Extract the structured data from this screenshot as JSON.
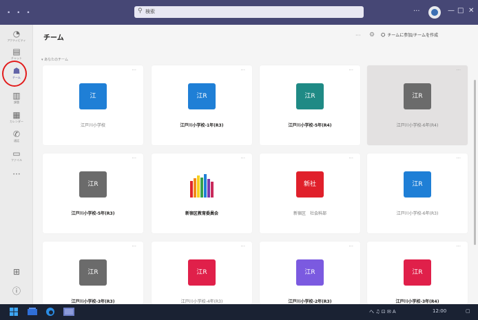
{
  "window": {
    "title_dots": "• • •",
    "search_placeholder": "検索",
    "more": "···",
    "minimize": "—",
    "maximize": "□",
    "close": "✕"
  },
  "rail": [
    {
      "label": "アクティビティ",
      "icon": "bell-icon"
    },
    {
      "label": "チャット",
      "icon": "chat-icon"
    },
    {
      "label": "チーム",
      "icon": "teams-icon",
      "active": true
    },
    {
      "label": "課題",
      "icon": "assignments-icon"
    },
    {
      "label": "カレンダー",
      "icon": "calendar-icon"
    },
    {
      "label": "通話",
      "icon": "phone-icon"
    },
    {
      "label": "ファイル",
      "icon": "files-icon"
    },
    {
      "label": "···",
      "icon": "more-icon"
    }
  ],
  "rail_bottom": [
    {
      "label": "",
      "icon": "apps-icon"
    },
    {
      "label": "",
      "icon": "help-icon"
    }
  ],
  "header": {
    "title": "チーム",
    "more": "···",
    "join_label": "チームに参加/チームを作成"
  },
  "section_label": "▾ あなたのチーム",
  "teams": [
    {
      "name": "江戸川小学校",
      "avatar": "江",
      "color": "#1f7fd6",
      "style": "faint"
    },
    {
      "name": "江戸川小学校-1年(R3)",
      "avatar": "江R",
      "color": "#1f7fd6",
      "style": "bold"
    },
    {
      "name": "江戸川小学校-5年(R4)",
      "avatar": "江R",
      "color": "#1f8a85",
      "style": "bold"
    },
    {
      "name": "江戸川小学校-6年(R4)",
      "avatar": "江R",
      "color": "#6b6b6b",
      "style": "faint",
      "selected": true
    },
    {
      "name": "江戸川小学校-5年(R3)",
      "avatar": "江R",
      "color": "#6b6b6b",
      "style": "bold"
    },
    {
      "name": "新宿区教育委員会",
      "avatar": "",
      "color": "#c92a5b",
      "style": "bold",
      "image": true
    },
    {
      "name": "新宿区　社会科部",
      "avatar": "新社",
      "color": "#e0202b",
      "style": "faint"
    },
    {
      "name": "江戸川小学校-6年(R3)",
      "avatar": "江R",
      "color": "#1f7fd6",
      "style": "faint"
    },
    {
      "name": "江戸川小学校-3年(R3)",
      "avatar": "江R",
      "color": "#6b6b6b",
      "style": "bold"
    },
    {
      "name": "江戸川小学校-4年(R3)",
      "avatar": "江R",
      "color": "#e0204a",
      "style": "faint"
    },
    {
      "name": "江戸川小学校-2年(R3)",
      "avatar": "江R",
      "color": "#7b5ae0",
      "style": "bold"
    },
    {
      "name": "江戸川小学校-3年(R4)",
      "avatar": "江R",
      "color": "#e0204a",
      "style": "bold"
    }
  ],
  "taskbar": {
    "tray_text": "へ ♫ ⊡ ✉ A",
    "clock": "12:00"
  }
}
